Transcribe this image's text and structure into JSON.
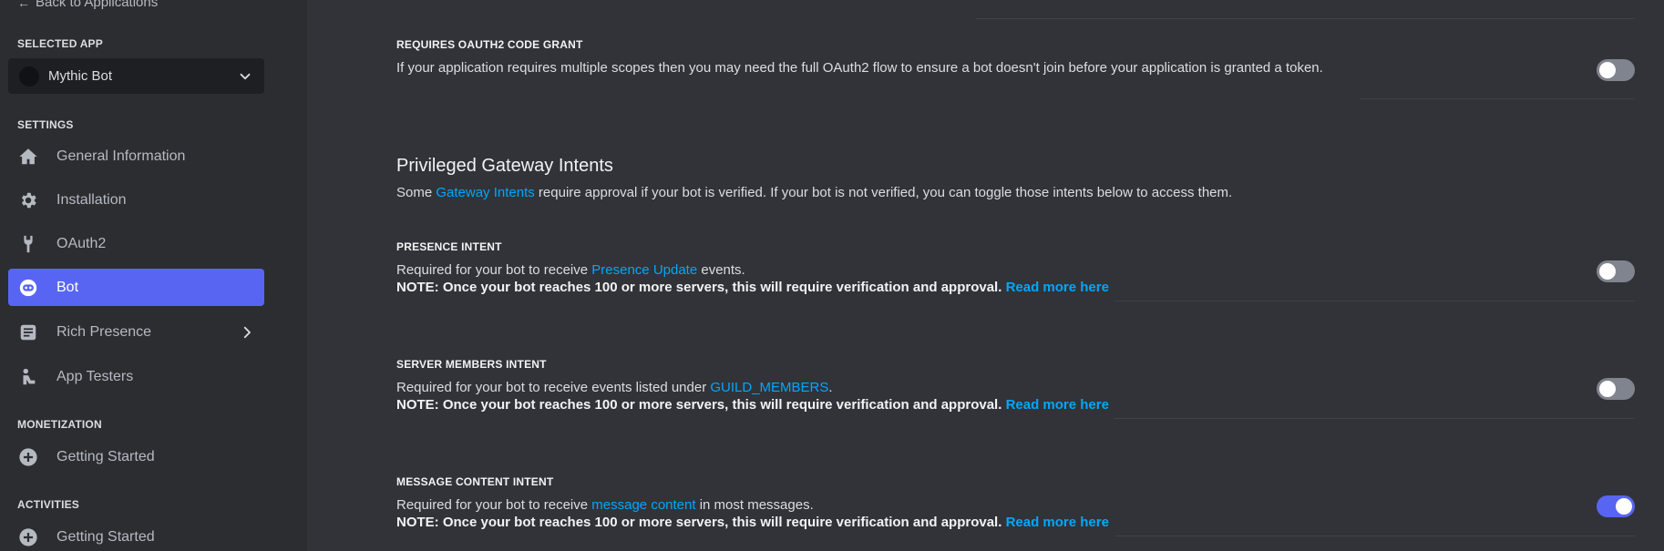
{
  "sidebar": {
    "back_label": "Back to Applications",
    "selected_app_header": "SELECTED APP",
    "selected_app_name": "Mythic Bot",
    "settings_header": "SETTINGS",
    "settings_items": [
      {
        "label": "General Information",
        "icon": "home-icon"
      },
      {
        "label": "Installation",
        "icon": "gear-icon"
      },
      {
        "label": "OAuth2",
        "icon": "wrench-icon"
      },
      {
        "label": "Bot",
        "icon": "bot-icon",
        "active": true
      },
      {
        "label": "Rich Presence",
        "icon": "document-icon"
      },
      {
        "label": "App Testers",
        "icon": "user-tester-icon"
      }
    ],
    "monetization_header": "MONETIZATION",
    "monetization_item": "Getting Started",
    "activities_header": "ACTIVITIES",
    "activities_item": "Getting Started"
  },
  "main": {
    "oauth_grant": {
      "title": "REQUIRES OAUTH2 CODE GRANT",
      "description": "If your application requires multiple scopes then you may need the full OAuth2 flow to ensure a bot doesn't join before your application is granted a token.",
      "enabled": false
    },
    "intents_section": {
      "title": "Privileged Gateway Intents",
      "desc_prefix": "Some ",
      "desc_link": "Gateway Intents",
      "desc_suffix": " require approval if your bot is verified. If your bot is not verified, you can toggle those intents below to access them."
    },
    "note_text": "NOTE: Once your bot reaches 100 or more servers, this will require verification and approval. ",
    "note_link": "Read more here",
    "presence": {
      "title": "PRESENCE INTENT",
      "desc_prefix": "Required for your bot to receive ",
      "desc_link": "Presence Update",
      "desc_suffix": " events.",
      "enabled": false
    },
    "members": {
      "title": "SERVER MEMBERS INTENT",
      "desc_prefix": "Required for your bot to receive events listed under ",
      "desc_link": "GUILD_MEMBERS",
      "desc_suffix": ".",
      "enabled": false
    },
    "message_content": {
      "title": "MESSAGE CONTENT INTENT",
      "desc_prefix": "Required for your bot to receive ",
      "desc_link": "message content",
      "desc_suffix": " in most messages.",
      "enabled": true
    }
  },
  "colors": {
    "accent": "#5865f2",
    "link": "#00a8fc",
    "sidebar_bg": "#2b2d31",
    "main_bg": "#313338"
  }
}
